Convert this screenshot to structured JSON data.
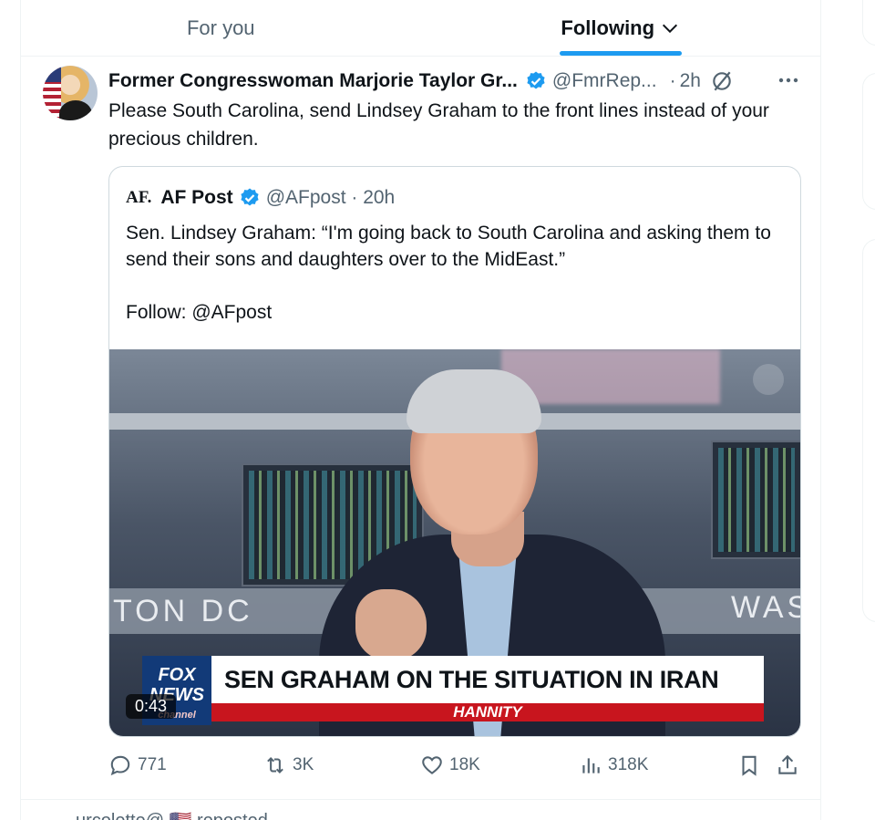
{
  "tabs": [
    {
      "label": "For you",
      "active": false
    },
    {
      "label": "Following",
      "active": true
    }
  ],
  "post": {
    "author_name": "Former Congresswoman Marjorie Taylor Gr...",
    "handle": "@FmrRep...",
    "separator": "·",
    "time": "2h",
    "text": "Please South Carolina, send Lindsey Graham to the front lines instead of your precious children.",
    "quote": {
      "logo": "AF.",
      "author_name": "AF Post",
      "handle_time": "@AFpost · 20h",
      "text_lines": [
        "Sen. Lindsey Graham: “I'm going back to South Carolina and asking them to send their sons and daughters over to the MidEast.”",
        "Follow: @AFpost"
      ],
      "video": {
        "duration": "0:43",
        "chyron_headline": "SEN GRAHAM ON THE SITUATION IN IRAN",
        "chyron_show": "HANNITY",
        "network_logo_top": "FOX",
        "network_logo_bottom": "NEWS",
        "network_logo_sub": "channel",
        "wall_text_left": "TON DC",
        "wall_text_right": "WAS"
      }
    },
    "metrics": {
      "replies": "771",
      "reposts": "3K",
      "likes": "18K",
      "views": "318K"
    }
  },
  "next_post": {
    "repost_line": "urcolette@ 🇺🇸 reposted"
  },
  "colors": {
    "accent": "#1d9bf0",
    "text": "#0f1419",
    "secondary": "#536471",
    "border": "#cfd9de"
  },
  "icons": [
    "chevron-down-icon",
    "verified-badge-icon",
    "grok-icon",
    "more-icon",
    "reply-icon",
    "repost-icon",
    "like-icon",
    "views-icon",
    "bookmark-icon",
    "share-icon"
  ]
}
